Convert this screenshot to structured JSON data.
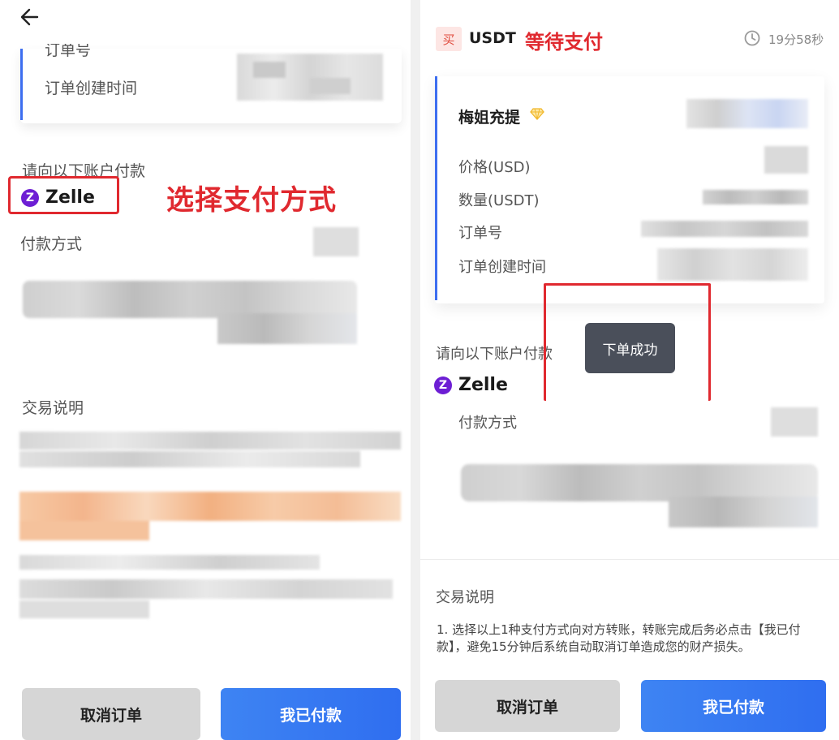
{
  "left": {
    "order_number_label_partial": "订单号",
    "order_created_label": "订单创建时间",
    "pay_to_label": "请向以下账户付款",
    "payment_method_name": "Zelle",
    "payment_method_icon": "zelle-icon",
    "annotation": "选择支付方式",
    "pay_method_label": "付款方式",
    "transaction_notes_label": "交易说明",
    "cancel_button": "取消订单",
    "paid_button": "我已付款"
  },
  "right": {
    "buy_badge": "买",
    "asset": "USDT",
    "status": "等待支付",
    "countdown": "19分58秒",
    "merchant_name": "梅姐充提",
    "merchant_badge_icon": "diamond-icon",
    "price_label": "价格(USD)",
    "quantity_label": "数量(USDT)",
    "order_number_label": "订单号",
    "order_created_label": "订单创建时间",
    "pay_to_label": "请向以下账户付款",
    "toast": "下单成功",
    "payment_method_name": "Zelle",
    "pay_method_label": "付款方式",
    "transaction_notes_label": "交易说明",
    "note_text": "1. 选择以上1种支付方式向对方转账，转账完成后务必点击【我已付款】，避免15分钟后系统自动取消订单造成您的财产损失。",
    "cancel_button": "取消订单",
    "paid_button": "我已付款"
  },
  "colors": {
    "accent_blue": "#3d6ef0",
    "annotation_red": "#e0292f",
    "zelle_purple": "#6d1ed4",
    "status_red": "#e0292f"
  }
}
